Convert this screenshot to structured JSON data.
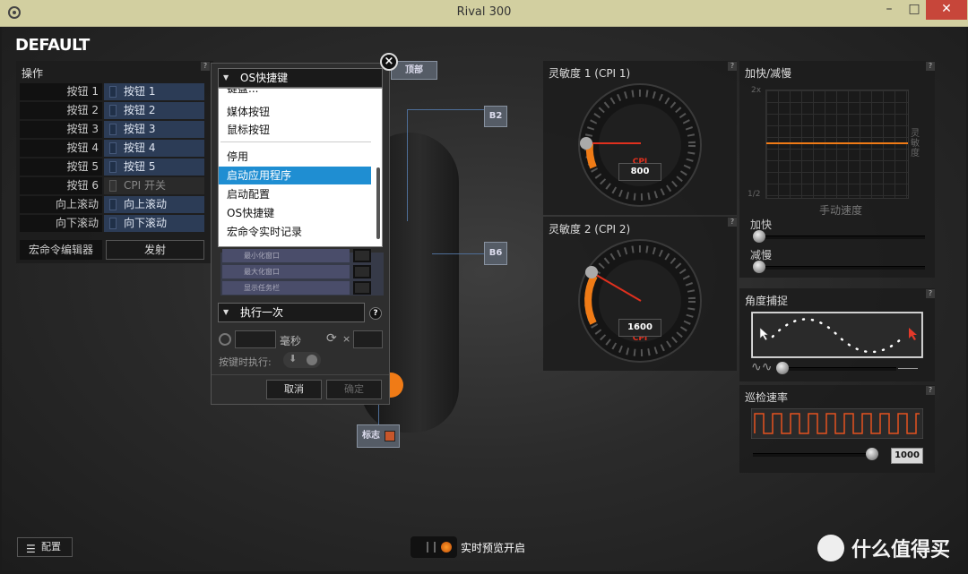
{
  "window": {
    "title": "Rival 300"
  },
  "profile": {
    "name": "DEFAULT"
  },
  "operations": {
    "title": "操作",
    "rows": [
      {
        "button": "按钮 1",
        "action": "按钮 1"
      },
      {
        "button": "按钮 2",
        "action": "按钮 2"
      },
      {
        "button": "按钮 3",
        "action": "按钮 3"
      },
      {
        "button": "按钮 4",
        "action": "按钮 4"
      },
      {
        "button": "按钮 5",
        "action": "按钮 5"
      },
      {
        "button": "按钮 6",
        "action": "CPI 开关"
      },
      {
        "button": "向上滚动",
        "action": "向上滚动"
      },
      {
        "button": "向下滚动",
        "action": "向下滚动"
      }
    ],
    "macro_editor": "宏命令编辑器",
    "fire": "发射"
  },
  "dialog": {
    "selected_type": "OS快捷键",
    "dropdown_items": [
      "媒体按钮",
      "鼠标按钮",
      "停用",
      "启动应用程序",
      "启动配置",
      "OS快捷键",
      "宏命令实时记录"
    ],
    "highlighted_item": "启动应用程序",
    "partial_top_item": "键盘...",
    "list_rows": [
      "最小化窗口",
      "最大化窗口",
      "显示任务栏"
    ],
    "execute_mode": "执行一次",
    "ms_unit": "毫秒",
    "repeat_x": "×",
    "on_press": "按键时执行:",
    "cancel": "取消",
    "confirm": "确定"
  },
  "mouse_callouts": {
    "top": "顶部",
    "b2": "B2",
    "b6": "B6",
    "logo": "标志"
  },
  "sensitivity1": {
    "title": "灵敏度 1 (CPI 1)",
    "unit": "CPI",
    "value": 800
  },
  "sensitivity2": {
    "title": "灵敏度 2 (CPI 2)",
    "unit": "CPI",
    "value": 1600
  },
  "acceleration": {
    "title": "加快/减慢",
    "y_top": "2x",
    "y_bottom": "1/2",
    "y_side": "灵敏度",
    "x_label": "手动速度",
    "accel_label": "加快",
    "decel_label": "减慢"
  },
  "angle_snap": {
    "title": "角度捕捉"
  },
  "polling": {
    "title": "巡检速率",
    "value": "1000"
  },
  "bottom": {
    "config": "配置",
    "live_preview": "实时预览开启",
    "watermark": "什么值得买"
  },
  "colors": {
    "accent": "#f07b16",
    "highlight": "#1f8ed2",
    "titlebar": "#d2cfa0"
  }
}
